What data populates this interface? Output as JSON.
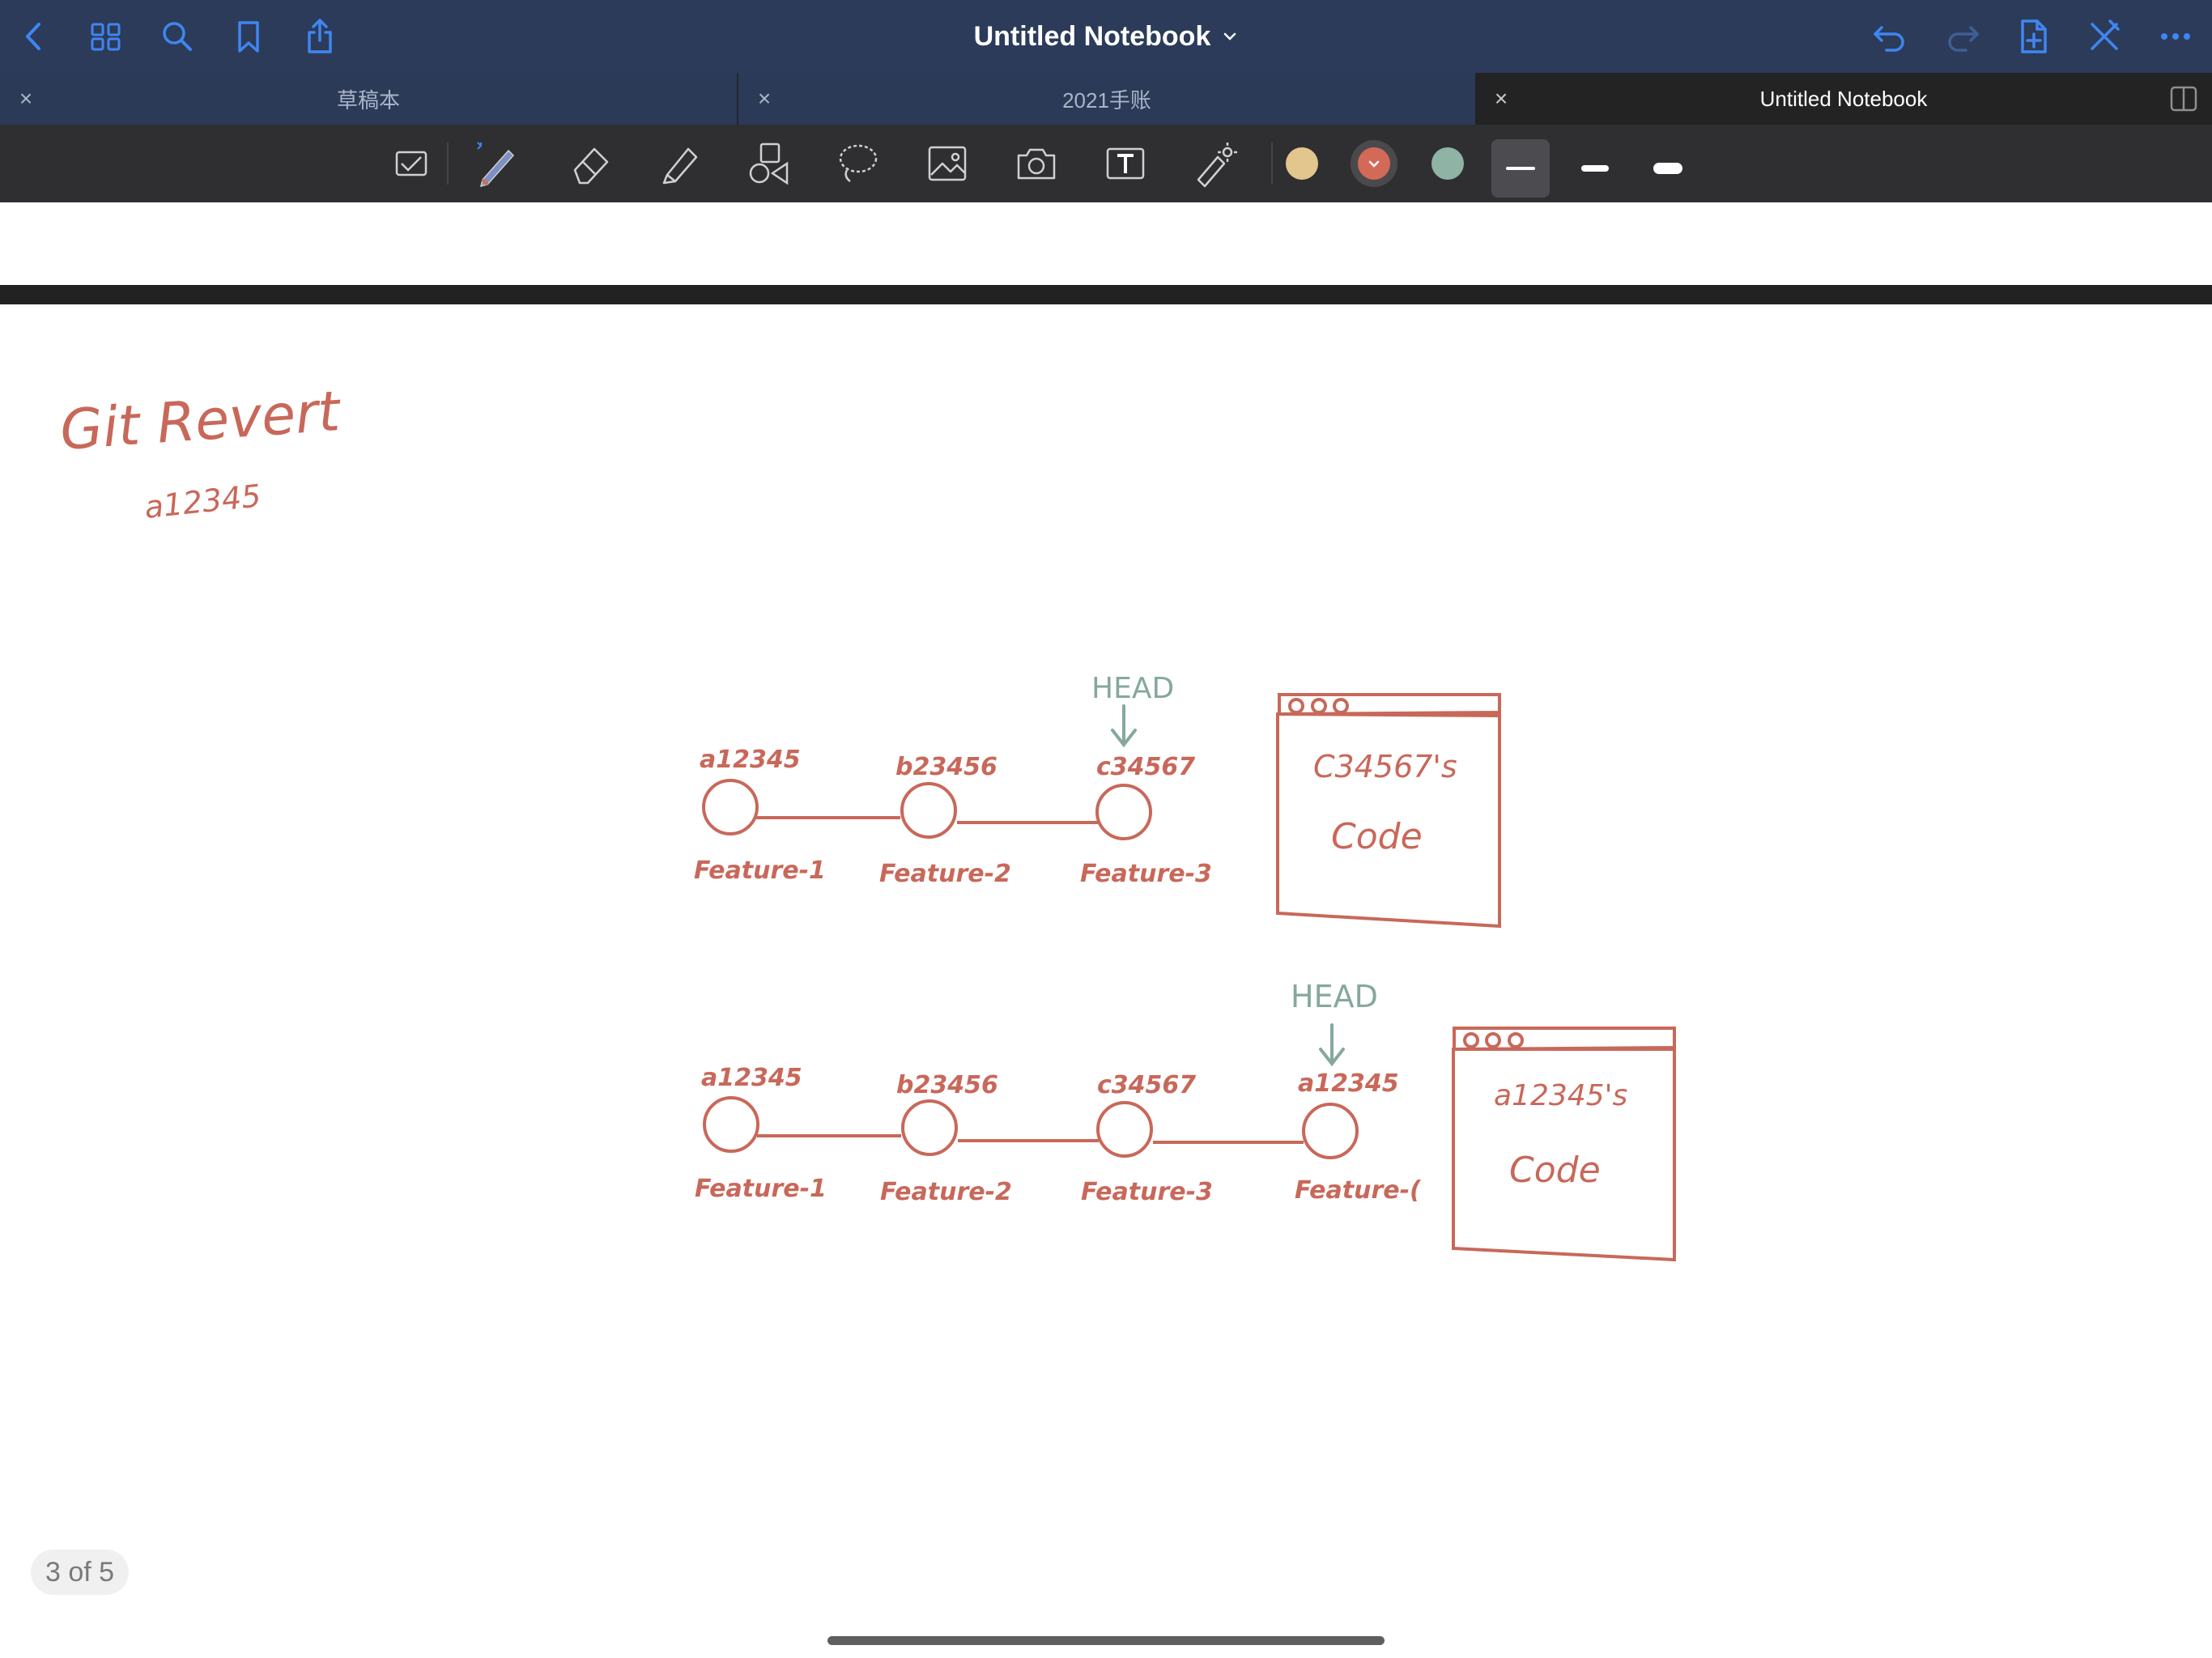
{
  "app": {
    "title": "Untitled Notebook",
    "tabs": [
      {
        "label": "草稿本"
      },
      {
        "label": "2021手账"
      },
      {
        "label": "Untitled Notebook"
      }
    ]
  },
  "nav_icons": [
    "back-icon",
    "thumbnails-icon",
    "search-icon",
    "bookmark-icon",
    "share-icon",
    "undo-icon",
    "redo-icon",
    "add-page-icon",
    "close-toolbar-icon",
    "more-icon"
  ],
  "toolbar": {
    "tools": [
      "read-only-toggle",
      "pen",
      "eraser",
      "highlighter",
      "shapes",
      "lasso",
      "image",
      "camera",
      "text",
      "laser-pointer"
    ],
    "colors": [
      "#e3c68e",
      "#d36a58",
      "#8fb3a5"
    ],
    "selected_color": "#d36a58",
    "stroke_widths": [
      "thin",
      "medium",
      "thick"
    ],
    "selected_stroke": "thin"
  },
  "ink": {
    "color": "#c8685a",
    "accent_color": "#86a89b",
    "heading": "Git Revert",
    "subheading": "a12345",
    "diagram_top": {
      "head_label": "HEAD",
      "commits": [
        {
          "hash": "a12345",
          "feature": "Feature-1"
        },
        {
          "hash": "b23456",
          "feature": "Feature-2"
        },
        {
          "hash": "c34567",
          "feature": "Feature-3"
        }
      ],
      "window_line1": "C34567's",
      "window_line2": "Code"
    },
    "diagram_bottom": {
      "head_label": "HEAD",
      "commits": [
        {
          "hash": "a12345",
          "feature": "Feature-1"
        },
        {
          "hash": "b23456",
          "feature": "Feature-2"
        },
        {
          "hash": "c34567",
          "feature": "Feature-3"
        },
        {
          "hash": "a12345",
          "feature": "Feature-("
        }
      ],
      "window_line1": "a12345's",
      "window_line2": "Code"
    }
  },
  "page_counter": "3 of 5"
}
